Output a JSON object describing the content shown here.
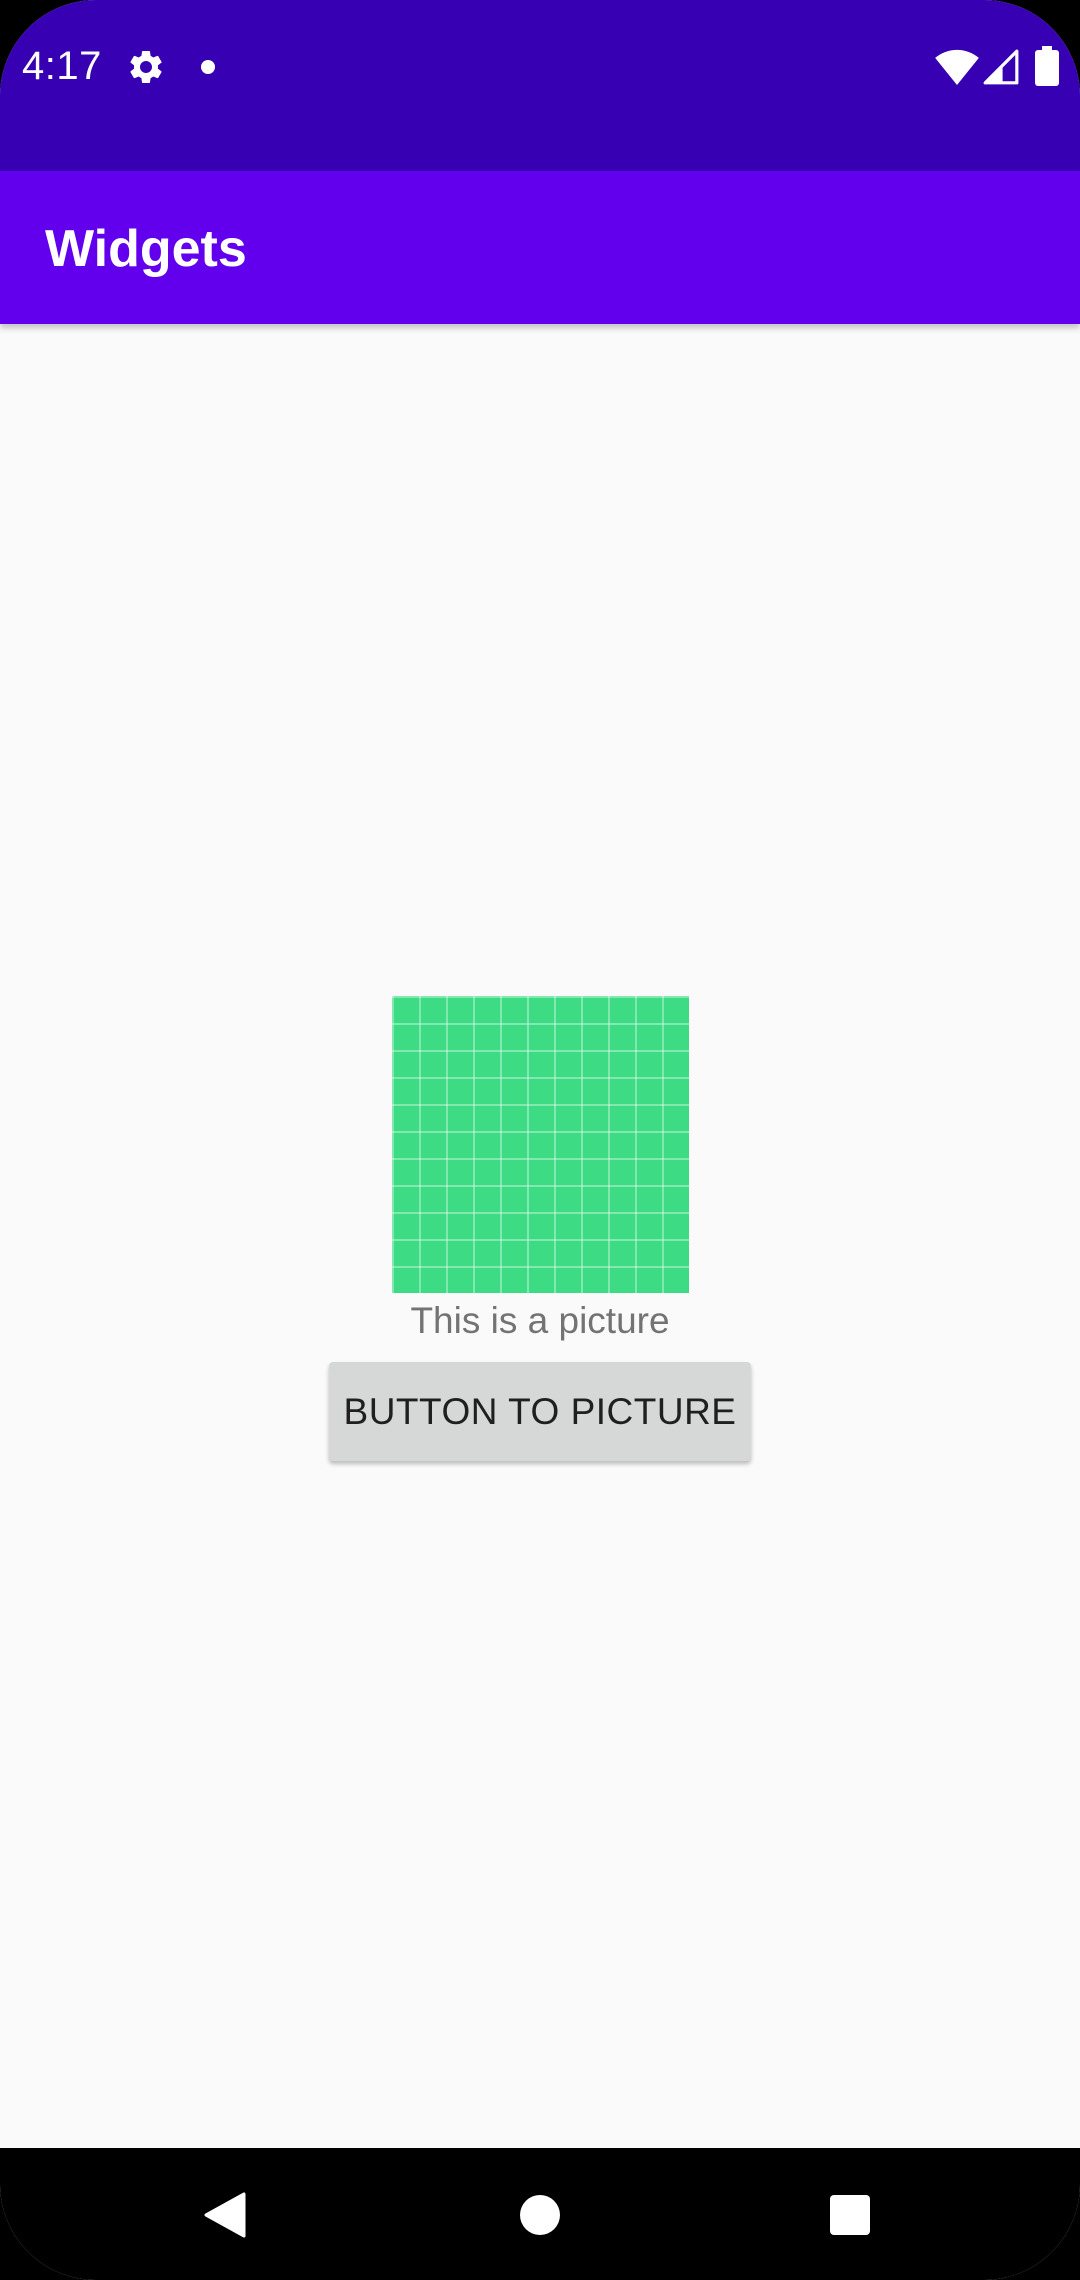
{
  "status_bar": {
    "time": "4:17",
    "icons": [
      "gear-icon",
      "notification-dot-icon",
      "wifi-icon",
      "cell-signal-icon",
      "battery-icon"
    ],
    "color": "#3700b3"
  },
  "app_bar": {
    "title": "Widgets",
    "color": "#6200ee"
  },
  "main": {
    "picture": {
      "icon": "grid-image-icon",
      "color": "#3ddc84"
    },
    "caption": "This is a picture",
    "button_label": "BUTTON TO PICTURE"
  },
  "nav_bar": {
    "icons": [
      "back-icon",
      "home-icon",
      "recents-icon"
    ]
  }
}
